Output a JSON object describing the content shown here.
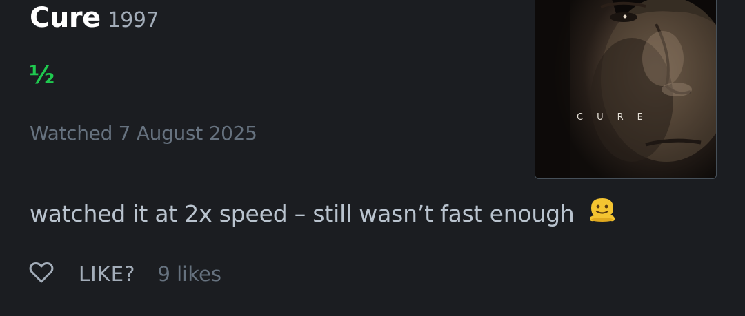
{
  "film": {
    "title": "Cure",
    "year": "1997",
    "rating": "½",
    "poster_title": "CURE"
  },
  "review": {
    "watched_date": "Watched 7 August 2025",
    "text": "watched it at 2x speed – still wasn’t fast enough",
    "emoji": "melting-face-emoji"
  },
  "actions": {
    "like_label": "LIKE?",
    "likes_count": "9 likes"
  },
  "colors": {
    "background": "#1b1d21",
    "rating_green": "#1fc94f",
    "muted_text": "#66727f",
    "body_text": "#b9c3ce"
  }
}
